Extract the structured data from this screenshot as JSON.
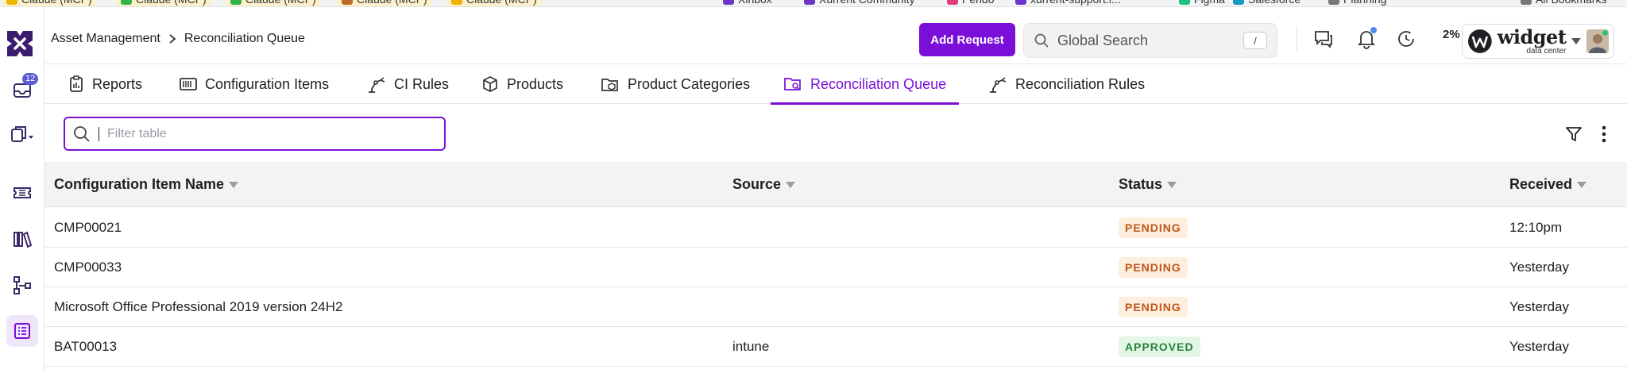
{
  "bookmarks": [
    {
      "label": "Claude (MCP)",
      "color": "#f0b400",
      "tinted": true
    },
    {
      "label": "Claude (MCP)",
      "color": "#35b34a",
      "tinted": true
    },
    {
      "label": "Claude (MCP)",
      "color": "#35b34a",
      "tinted": true
    },
    {
      "label": "Claude (MCP)",
      "color": "#c06a2b",
      "tinted": true
    },
    {
      "label": "Claude (MCP)",
      "color": "#f0b400",
      "tinted": true
    },
    {
      "label": "Xinbox",
      "color": "#6a36c9",
      "tinted": false
    },
    {
      "label": "Xurrent Community",
      "color": "#6a36c9",
      "tinted": false
    },
    {
      "label": "Pendo",
      "color": "#e43b7b",
      "tinted": false
    },
    {
      "label": "xurrent-support.i...",
      "color": "#6a36c9",
      "tinted": false
    },
    {
      "label": "Figma",
      "color": "#1bc47d",
      "tinted": false
    },
    {
      "label": "Salesforce",
      "color": "#1798c1",
      "tinted": false
    },
    {
      "label": "Planning",
      "color": "#777777",
      "tinted": false
    },
    {
      "label": "All Bookmarks",
      "color": "#777777",
      "tinted": false
    }
  ],
  "rail": {
    "inbox_badge": "12"
  },
  "header": {
    "breadcrumb_parent": "Asset Management",
    "breadcrumb_current": "Reconciliation Queue",
    "add_request_label": "Add Request",
    "search_placeholder": "Global Search",
    "search_shortcut": "/",
    "progress_label": "2%",
    "brand_name": "widget",
    "brand_sub": "data center",
    "accent_color": "#7a10d8"
  },
  "tabs": [
    {
      "label": "Reports",
      "icon": "clipboard-icon",
      "active": false
    },
    {
      "label": "Configuration Items",
      "icon": "server-rack-icon",
      "active": false
    },
    {
      "label": "CI Rules",
      "icon": "robot-arm-icon",
      "active": false
    },
    {
      "label": "Products",
      "icon": "cube-icon",
      "active": false
    },
    {
      "label": "Product Categories",
      "icon": "folder-cube-icon",
      "active": false
    },
    {
      "label": "Reconciliation Queue",
      "icon": "folder-search-icon",
      "active": true
    },
    {
      "label": "Reconciliation Rules",
      "icon": "robot-arm-icon",
      "active": false
    }
  ],
  "filter": {
    "placeholder": "Filter table"
  },
  "table": {
    "columns": [
      {
        "label": "Configuration Item Name"
      },
      {
        "label": "Source"
      },
      {
        "label": "Status"
      },
      {
        "label": "Received"
      }
    ],
    "rows": [
      {
        "name": "CMP00021",
        "source": "",
        "status": "PENDING",
        "status_kind": "pending",
        "received": "12:10pm"
      },
      {
        "name": "CMP00033",
        "source": "",
        "status": "PENDING",
        "status_kind": "pending",
        "received": "Yesterday"
      },
      {
        "name": "Microsoft Office Professional 2019 version 24H2",
        "source": "",
        "status": "PENDING",
        "status_kind": "pending",
        "received": "Yesterday"
      },
      {
        "name": "BAT00013",
        "source": "intune",
        "status": "APPROVED",
        "status_kind": "approved",
        "received": "Yesterday"
      }
    ]
  },
  "status_colors": {
    "pending_bg": "#fdeedd",
    "pending_fg": "#c0561b",
    "approved_bg": "#e4f6e6",
    "approved_fg": "#26833c"
  }
}
